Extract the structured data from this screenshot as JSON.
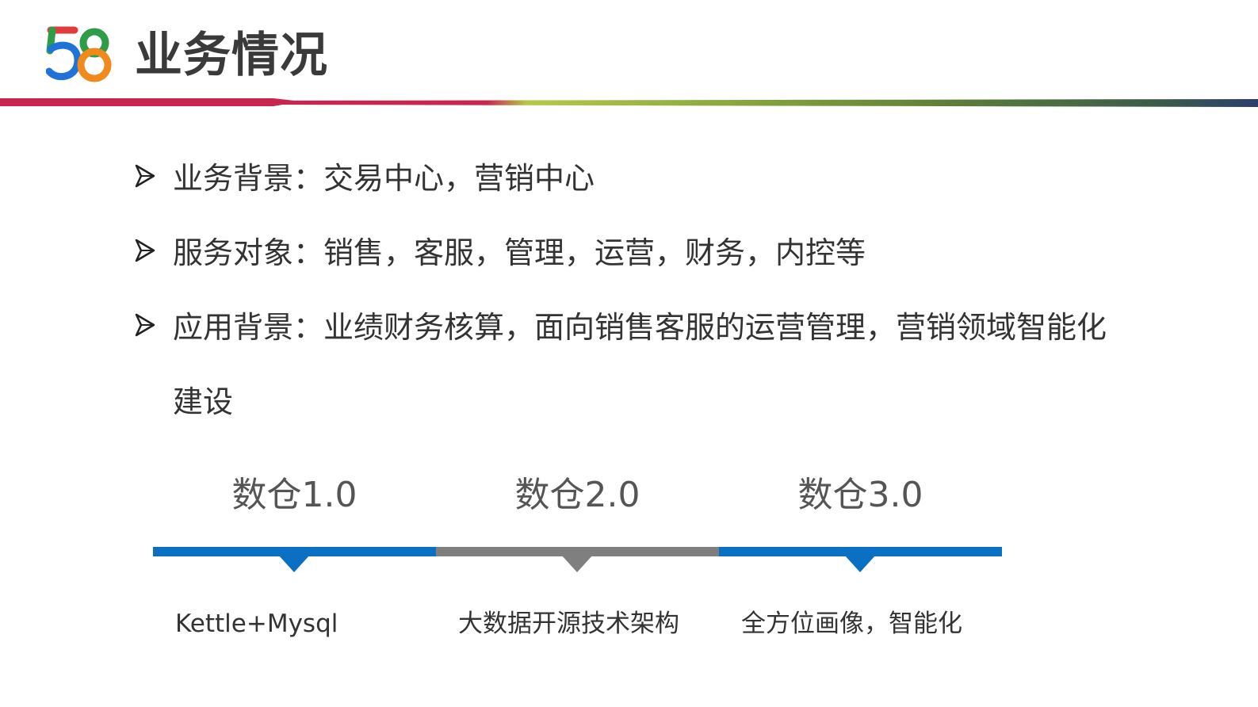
{
  "header": {
    "logo_text": "58",
    "title": "业务情况",
    "bar_colors": [
      "#c9264f",
      "#a8c040",
      "#6b8e3a",
      "#2d3e6e"
    ]
  },
  "bullets": [
    {
      "text": "业务背景：交易中心，营销中心"
    },
    {
      "text": "服务对象：销售，客服，管理，运营，财务，内控等"
    },
    {
      "text": "应用背景：业绩财务核算，面向销售客服的运营管理，营销领域智能化建设"
    }
  ],
  "timeline": {
    "stages": [
      {
        "label": "数仓1.0",
        "desc": "Kettle+Mysql",
        "color": "#0b6fc4"
      },
      {
        "label": "数仓2.0",
        "desc": "大数据开源技术架构",
        "color": "#7f7f7f"
      },
      {
        "label": "数仓3.0",
        "desc": "全方位画像，智能化",
        "color": "#0b6fc4"
      }
    ]
  },
  "icons": {
    "bullet": "arrowhead-icon",
    "logo": "58-logo-icon"
  }
}
